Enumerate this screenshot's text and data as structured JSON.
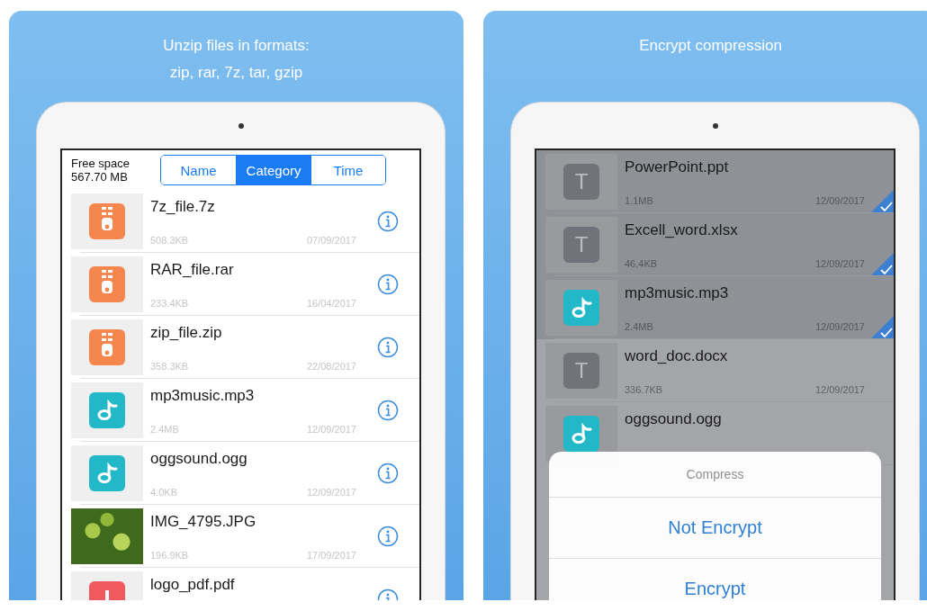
{
  "panels": [
    {
      "caption_lines": [
        "Unzip files in formats:",
        "zip, rar, 7z, tar, gzip"
      ],
      "header": {
        "label": "Free space",
        "value": "567.70 MB",
        "segments": [
          {
            "label": "Name",
            "selected": false
          },
          {
            "label": "Category",
            "selected": true
          },
          {
            "label": "Time",
            "selected": false
          }
        ]
      },
      "files": [
        {
          "kind": "archive",
          "name": "7z_file.7z",
          "size": "508.3KB",
          "date": "07/09/2017"
        },
        {
          "kind": "archive",
          "name": "RAR_file.rar",
          "size": "233.4KB",
          "date": "16/04/2017"
        },
        {
          "kind": "archive",
          "name": "zip_file.zip",
          "size": "358.3KB",
          "date": "22/08/2017"
        },
        {
          "kind": "audio",
          "name": "mp3music.mp3",
          "size": "2.4MB",
          "date": "12/09/2017"
        },
        {
          "kind": "audio",
          "name": "oggsound.ogg",
          "size": "4.0KB",
          "date": "12/09/2017"
        },
        {
          "kind": "photo",
          "name": "IMG_4795.JPG",
          "size": "196.9KB",
          "date": "17/09/2017"
        },
        {
          "kind": "pdf",
          "name": "logo_pdf.pdf"
        }
      ]
    },
    {
      "caption_lines": [
        "Encrypt compression"
      ],
      "files": [
        {
          "kind": "text",
          "icon_letter": "T",
          "name": "PowerPoint.ppt",
          "size": "1.1MB",
          "date": "12/09/2017",
          "selected": true
        },
        {
          "kind": "text",
          "icon_letter": "T",
          "name": "Excell_word.xlsx",
          "size": "46.4KB",
          "date": "12/09/2017",
          "selected": true
        },
        {
          "kind": "audio",
          "name": "mp3music.mp3",
          "size": "2.4MB",
          "date": "12/09/2017",
          "selected": true
        },
        {
          "kind": "text",
          "icon_letter": "T",
          "name": "word_doc.docx",
          "size": "336.7KB",
          "date": "12/09/2017",
          "selected": false
        },
        {
          "kind": "audio",
          "name": "oggsound.ogg",
          "selected": false
        }
      ],
      "sheet": {
        "title": "Compress",
        "actions": [
          "Not Encrypt",
          "Encrypt"
        ]
      }
    }
  ]
}
